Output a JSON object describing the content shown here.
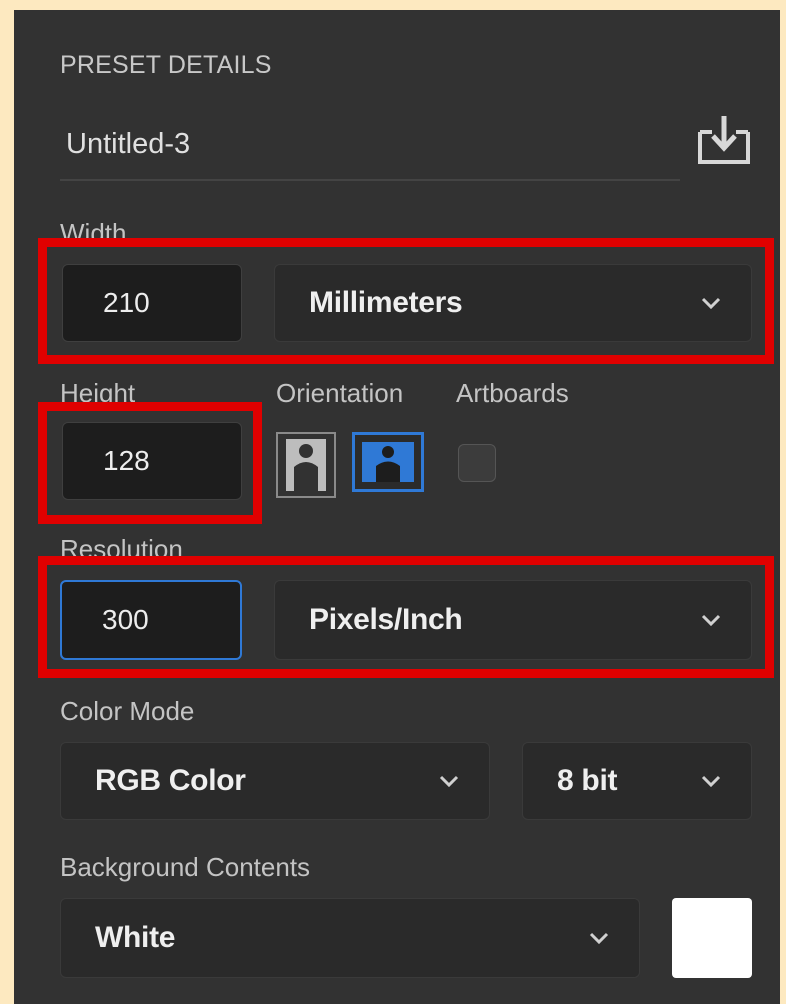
{
  "preset": {
    "section_title": "PRESET DETAILS",
    "document_name": "Untitled-3"
  },
  "width": {
    "label": "Width",
    "value": "210",
    "unit": "Millimeters"
  },
  "height": {
    "label": "Height",
    "value": "128"
  },
  "orientation": {
    "label": "Orientation",
    "options": [
      "portrait",
      "landscape"
    ],
    "selected": "landscape"
  },
  "artboards": {
    "label": "Artboards",
    "checked": false
  },
  "resolution": {
    "label": "Resolution",
    "value": "300",
    "unit": "Pixels/Inch"
  },
  "color_mode": {
    "label": "Color Mode",
    "mode": "RGB Color",
    "depth": "8 bit"
  },
  "background": {
    "label": "Background Contents",
    "value": "White",
    "swatch_color": "#ffffff"
  },
  "colors": {
    "panel_bg": "#323232",
    "page_bg": "#fde9c0",
    "highlight_red": "#e00000",
    "accent_blue": "#2f79d6"
  },
  "icons": {
    "save_preset": "download-tray-icon",
    "dropdown": "chevron-down-icon"
  }
}
